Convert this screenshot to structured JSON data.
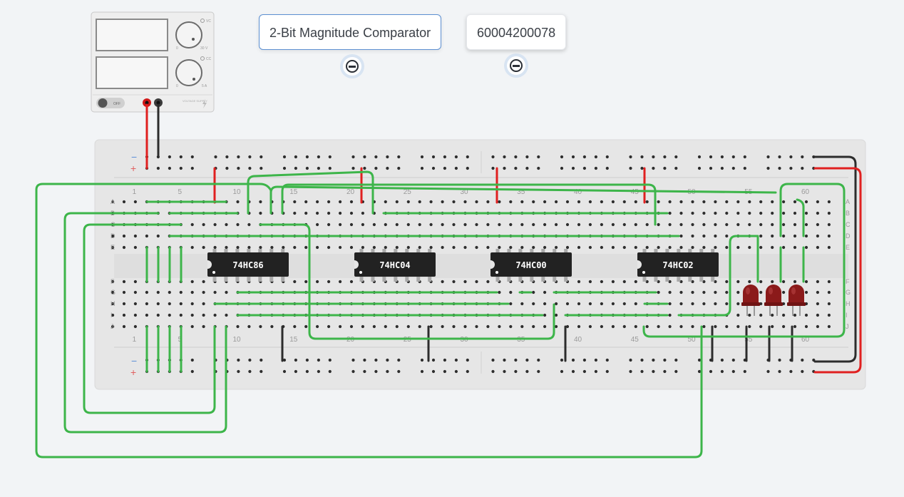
{
  "annotations": {
    "title": "2-Bit Magnitude Comparator",
    "id_note": "60004200078"
  },
  "power_supply": {
    "switch_label": "OFF",
    "brand_label": "VOLTAGE SUPPLY",
    "voltage_label": "30 V",
    "current_label": "5 A",
    "vc_label": "VC",
    "cc_label": "CC",
    "zero_label": "0"
  },
  "breadboard": {
    "row_labels_top": [
      "A",
      "B",
      "C",
      "D",
      "E"
    ],
    "row_labels_bottom": [
      "F",
      "G",
      "H",
      "I",
      "J"
    ],
    "column_numbers": [
      "1",
      "5",
      "10",
      "15",
      "20",
      "25",
      "30",
      "35",
      "40",
      "45",
      "50",
      "55",
      "60"
    ],
    "rail_minus": "−",
    "rail_plus": "+"
  },
  "chips": [
    {
      "label": "74HC86"
    },
    {
      "label": "74HC04"
    },
    {
      "label": "74HC00"
    },
    {
      "label": "74HC02"
    }
  ],
  "leds": [
    {
      "color": "#8b1a1a"
    },
    {
      "color": "#8b1a1a"
    },
    {
      "color": "#8b1a1a"
    }
  ],
  "colors": {
    "wire_green": "#3db54a",
    "wire_red": "#e02020",
    "wire_black": "#2c2c2c",
    "board": "#e6e6e6",
    "chip": "#222222",
    "led": "#8b1a1a"
  }
}
